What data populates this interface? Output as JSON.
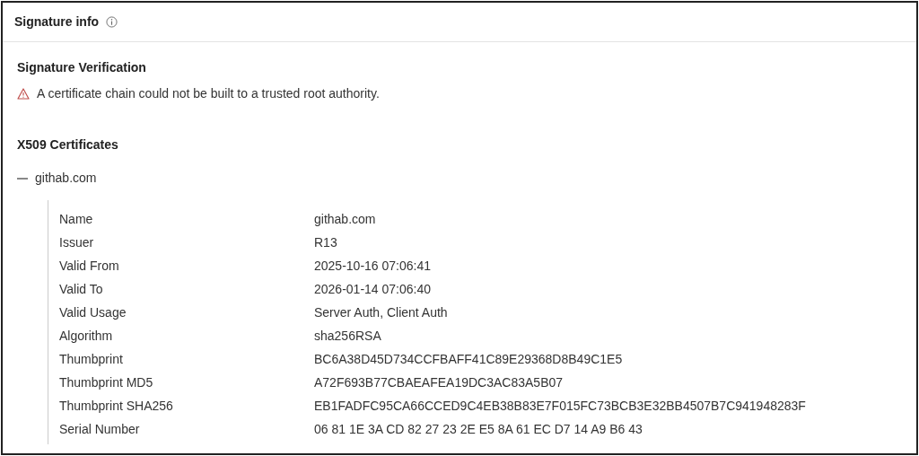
{
  "panel": {
    "title": "Signature info"
  },
  "verification": {
    "heading": "Signature Verification",
    "warning": "A certificate chain could not be built to a trusted root authority."
  },
  "certificates": {
    "heading": "X509 Certificates",
    "items": [
      {
        "name": "githab.com",
        "expanded": true,
        "fields": [
          {
            "label": "Name",
            "value": "githab.com"
          },
          {
            "label": "Issuer",
            "value": "R13"
          },
          {
            "label": "Valid From",
            "value": "2025-10-16 07:06:41"
          },
          {
            "label": "Valid To",
            "value": "2026-01-14 07:06:40"
          },
          {
            "label": "Valid Usage",
            "value": "Server Auth, Client Auth"
          },
          {
            "label": "Algorithm",
            "value": "sha256RSA"
          },
          {
            "label": "Thumbprint",
            "value": "BC6A38D45D734CCFBAFF41C89E29368D8B49C1E5"
          },
          {
            "label": "Thumbprint MD5",
            "value": "A72F693B77CBAEAFEA19DC3AC83A5B07"
          },
          {
            "label": "Thumbprint SHA256",
            "value": "EB1FADFC95CA66CCED9C4EB38B83E7F015FC73BCB3E32BB4507B7C941948283F"
          },
          {
            "label": "Serial Number",
            "value": "06 81 1E 3A CD 82 27 23 2E E5 8A 61 EC D7 14 A9 B6 43"
          }
        ]
      }
    ]
  }
}
